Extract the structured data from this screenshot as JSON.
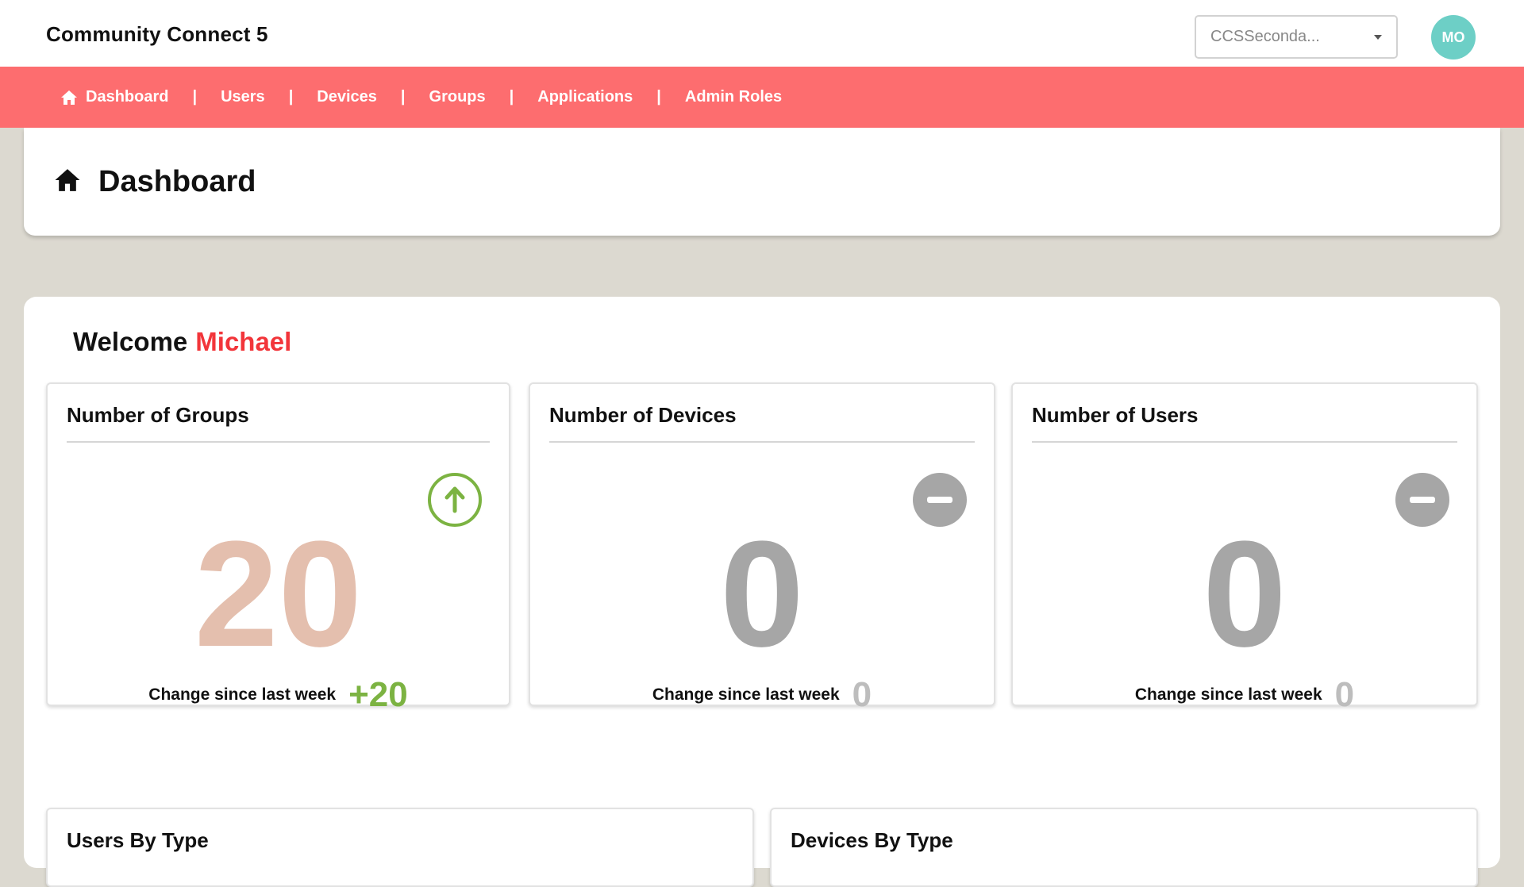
{
  "app": {
    "title": "Community Connect 5"
  },
  "org_select": {
    "value": "CCSSeconda..."
  },
  "avatar": {
    "initials": "MO",
    "color": "#6dcfc6"
  },
  "nav": {
    "color": "#fd6d6f",
    "separator": "|",
    "items": [
      {
        "label": "Dashboard",
        "icon": "home-icon"
      },
      {
        "label": "Users"
      },
      {
        "label": "Devices"
      },
      {
        "label": "Groups"
      },
      {
        "label": "Applications"
      },
      {
        "label": "Admin Roles"
      }
    ]
  },
  "page": {
    "title": "Dashboard",
    "icon": "home-icon"
  },
  "welcome": {
    "greeting": "Welcome",
    "name": "Michael",
    "name_color": "#f2353a"
  },
  "stats": [
    {
      "title": "Number of Groups",
      "value": "20",
      "change_label": "Change since last week",
      "change": "+20",
      "trend": "up",
      "trend_icon": "arrow-up-circle-icon",
      "value_color": "#e4bfae",
      "change_color": "#7cb342"
    },
    {
      "title": "Number of Devices",
      "value": "0",
      "change_label": "Change since last week",
      "change": "0",
      "trend": "none",
      "trend_icon": "minus-circle-icon",
      "value_color": "#a6a6a6",
      "change_color": "#bdbdbd"
    },
    {
      "title": "Number of Users",
      "value": "0",
      "change_label": "Change since last week",
      "change": "0",
      "trend": "none",
      "trend_icon": "minus-circle-icon",
      "value_color": "#a6a6a6",
      "change_color": "#bdbdbd"
    }
  ],
  "type_cards": [
    {
      "title": "Users By Type"
    },
    {
      "title": "Devices By Type"
    }
  ]
}
